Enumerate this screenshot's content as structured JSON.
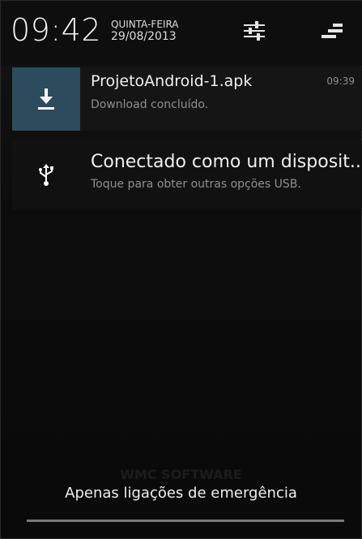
{
  "status": {
    "time": "09:42",
    "weekday": "QUINTA-FEIRA",
    "date": "29/08/2013",
    "settings_icon": "quick-settings-sliders-icon",
    "clear_icon": "clear-all-notifications-icon"
  },
  "notifications": [
    {
      "icon": "download-icon",
      "title": "ProjetoAndroid-1.apk",
      "subtitle": "Download concluído.",
      "time": "09:39",
      "accent": "#2c4b5d"
    },
    {
      "icon": "usb-icon",
      "title": "Conectado como um disposit..",
      "subtitle": "Toque para obter outras opções USB.",
      "time": ""
    }
  ],
  "background": {
    "brand": "WMC SOFTWARE"
  },
  "footer": {
    "emergency_text": "Apenas ligações de emergência"
  }
}
